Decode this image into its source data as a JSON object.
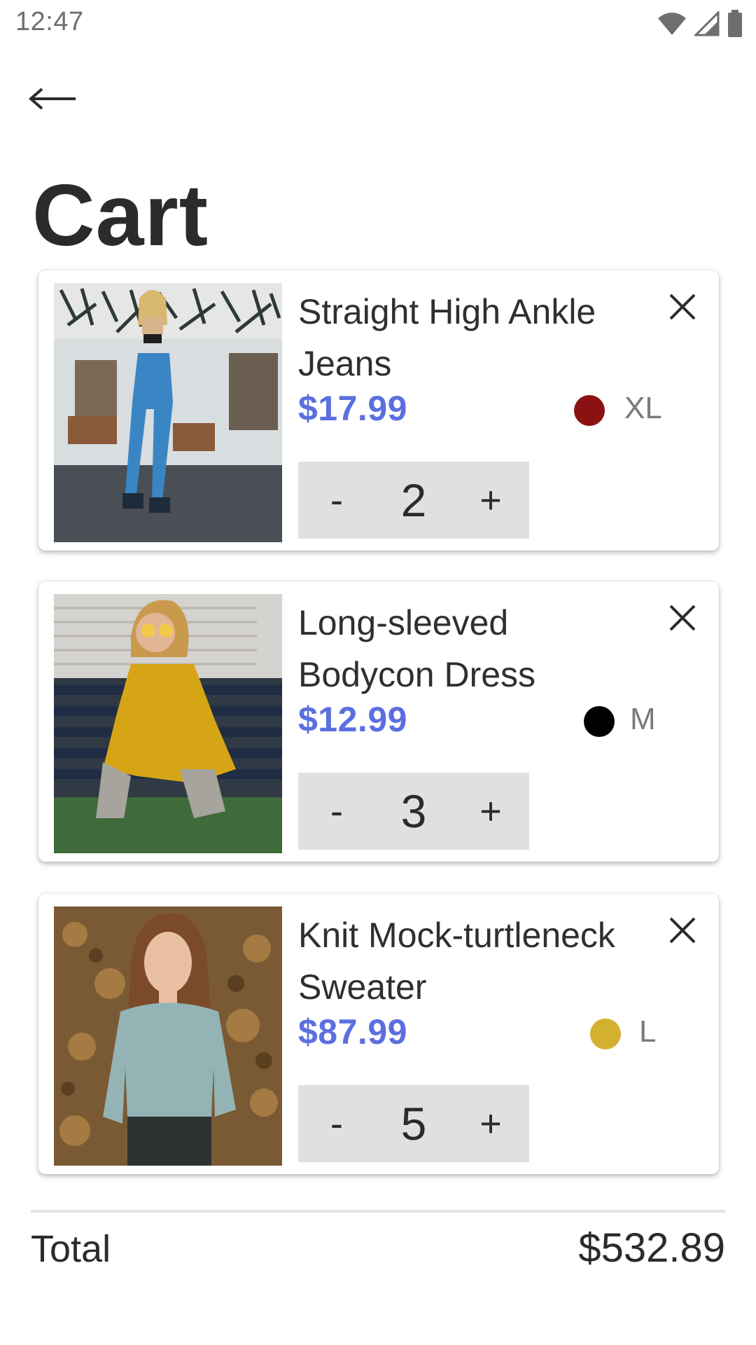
{
  "status_bar": {
    "time": "12:47",
    "icons": [
      "wifi-icon",
      "signal-icon",
      "battery-icon"
    ]
  },
  "header": {
    "back_icon": "arrow-left-icon",
    "title": "Cart"
  },
  "colors": {
    "accent_price": "#5b6fe0",
    "stepper_bg": "#e0e0e0"
  },
  "cart": {
    "items": [
      {
        "name": "Straight High Ankle Jeans",
        "price": "$17.99",
        "color_swatch": "#8b1212",
        "size": "XL",
        "quantity": "2",
        "decrement_label": "-",
        "increment_label": "+",
        "remove_icon": "close-icon"
      },
      {
        "name": "Long-sleeved Bodycon Dress",
        "price": "$12.99",
        "color_swatch": "#000000",
        "size": "M",
        "quantity": "3",
        "decrement_label": "-",
        "increment_label": "+",
        "remove_icon": "close-icon"
      },
      {
        "name": "Knit Mock-turtleneck Sweater",
        "price": "$87.99",
        "color_swatch": "#d4b030",
        "size": "L",
        "quantity": "5",
        "decrement_label": "-",
        "increment_label": "+",
        "remove_icon": "close-icon"
      }
    ]
  },
  "footer": {
    "total_label": "Total",
    "total_value": "$532.89"
  }
}
